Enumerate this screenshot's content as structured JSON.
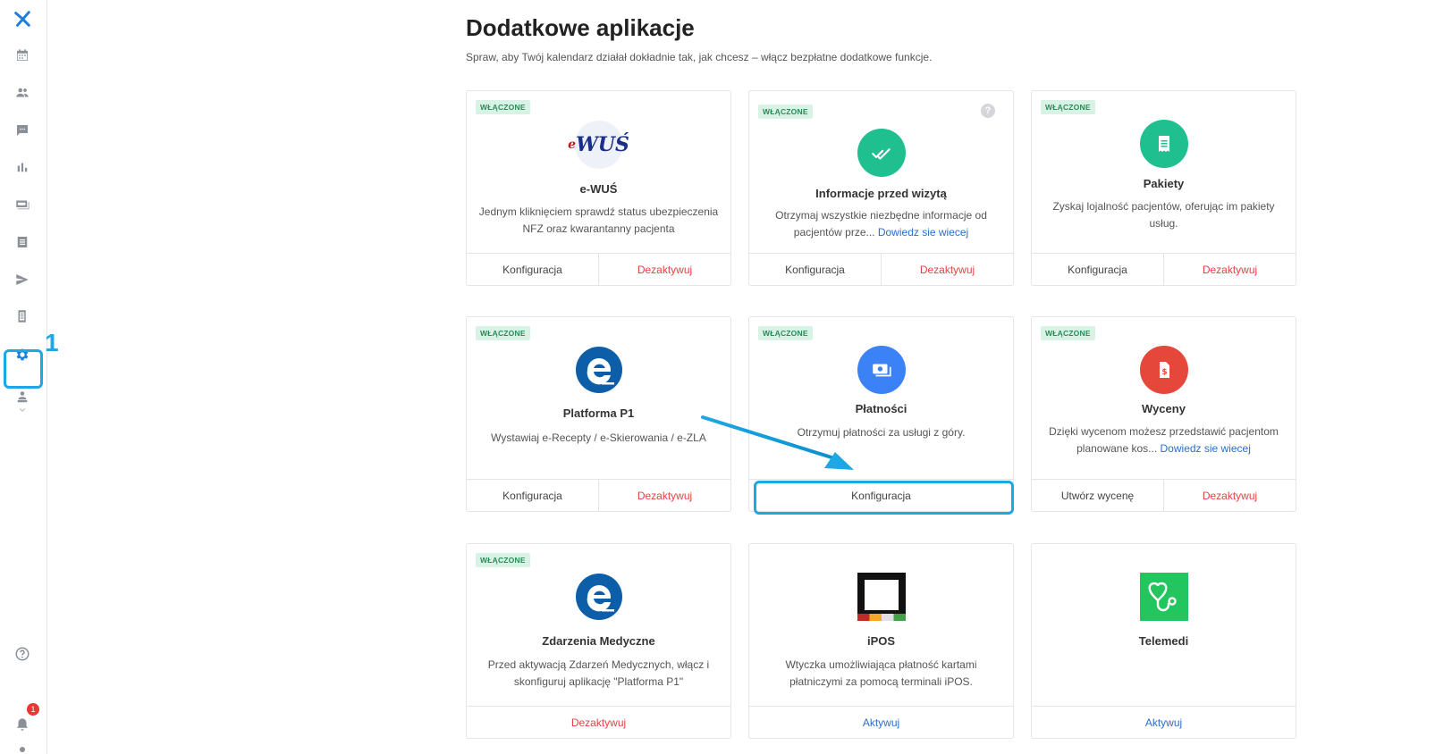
{
  "sidebar": {
    "step_number": "1",
    "notifications_count": "1"
  },
  "page": {
    "title": "Dodatkowe aplikacje",
    "subtitle": "Spraw, aby Twój kalendarz działał dokładnie tak, jak chcesz – włącz bezpłatne dodatkowe funkcje."
  },
  "colors": {
    "accent": "#1ca8e3",
    "green": "#1fbf8f",
    "blue": "#3b82f6",
    "red": "#e5483a",
    "link": "#2a6fc9"
  },
  "cards": [
    {
      "badge": "WŁĄCZONE",
      "title": "e-WUŚ",
      "logo_text": "WUŚ",
      "logo_prefix": "e",
      "desc": "Jednym kliknięciem sprawdź status ubezpieczenia NFZ oraz kwarantanny pacjenta",
      "btn1": "Konfiguracja",
      "btn2": "Dezaktywuj"
    },
    {
      "badge": "WŁĄCZONE",
      "help": "?",
      "title": "Informacje przed wizytą",
      "desc": "Otrzymaj wszystkie niezbędne informacje od pacjentów prze...",
      "link": "Dowiedz sie wiecej",
      "btn1": "Konfiguracja",
      "btn2": "Dezaktywuj"
    },
    {
      "badge": "WŁĄCZONE",
      "title": "Pakiety",
      "desc": "Zyskaj lojalność pacjentów, oferując im pakiety usług.",
      "btn1": "Konfiguracja",
      "btn2": "Dezaktywuj"
    },
    {
      "badge": "WŁĄCZONE",
      "title": "Platforma P1",
      "desc": "Wystawiaj e-Recepty / e-Skierowania / e-ZLA",
      "btn1": "Konfiguracja",
      "btn2": "Dezaktywuj"
    },
    {
      "badge": "WŁĄCZONE",
      "title": "Płatności",
      "desc": "Otrzymuj płatności za usługi z góry.",
      "btn1": "Konfiguracja"
    },
    {
      "badge": "WŁĄCZONE",
      "title": "Wyceny",
      "desc": "Dzięki wycenom możesz przedstawić pacjentom planowane kos...",
      "link": "Dowiedz sie wiecej",
      "btn1": "Utwórz wycenę",
      "btn2": "Dezaktywuj"
    },
    {
      "badge": "WŁĄCZONE",
      "title": "Zdarzenia Medyczne",
      "desc": "Przed aktywacją Zdarzeń Medycznych, włącz i skonfiguruj aplikację \"Platforma P1\"",
      "btn1": "Dezaktywuj"
    },
    {
      "title": "iPOS",
      "desc": "Wtyczka umożliwiająca płatność kartami płatniczymi za pomocą terminali iPOS.",
      "btn1": "Aktywuj"
    },
    {
      "title": "Telemedi",
      "btn1": "Aktywuj"
    }
  ]
}
